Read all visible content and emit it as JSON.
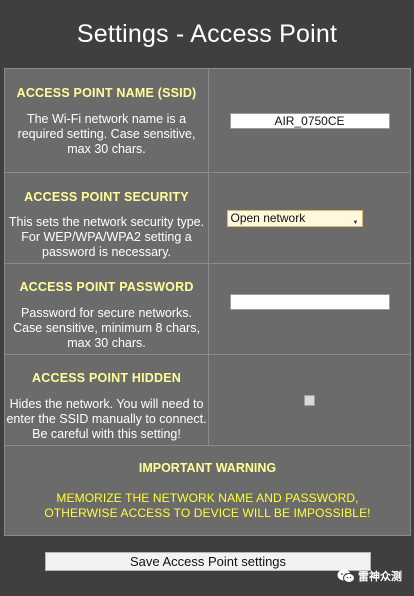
{
  "page": {
    "title": "Settings - Access Point"
  },
  "sections": {
    "ssid": {
      "heading": "ACCESS POINT NAME (SSID)",
      "desc_lines": [
        "The Wi-Fi network name is a",
        "required setting. Case sensitive,",
        "max 30 chars."
      ],
      "value": "AIR_0750CE"
    },
    "security": {
      "heading": "ACCESS POINT SECURITY",
      "desc_lines": [
        "This sets the network security type.",
        "For WEP/WPA/WPA2 setting a",
        "password is necessary."
      ],
      "selected": "Open network"
    },
    "password": {
      "heading": "ACCESS POINT PASSWORD",
      "desc_lines": [
        "Password for secure networks.",
        "Case sensitive, minimum 8 chars,",
        "max 30 chars."
      ],
      "value": ""
    },
    "hidden": {
      "heading": "ACCESS POINT HIDDEN",
      "desc_lines": [
        "Hides the network. You will need to",
        "enter the SSID manually to connect.",
        "Be careful with this setting!"
      ],
      "checked": false
    }
  },
  "warning": {
    "heading": "IMPORTANT WARNING",
    "lines": [
      "MEMORIZE THE NETWORK NAME AND PASSWORD,",
      "OTHERWISE ACCESS TO DEVICE WILL BE IMPOSSIBLE!"
    ]
  },
  "save_button": {
    "label": "Save Access Point settings"
  },
  "watermark": {
    "text": "雷神众测",
    "icon": "wechat-icon"
  },
  "colors": {
    "background": "#3f3f3f",
    "panel": "#6b6b6b",
    "heading": "#ffff99",
    "warning_text": "#ffff33"
  }
}
